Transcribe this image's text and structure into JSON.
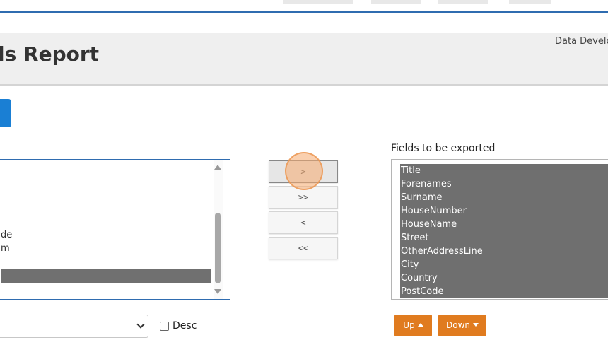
{
  "header": {
    "title": "ls Report",
    "breadcrumb": "Data Develo"
  },
  "available_fields": {
    "visible_items": [
      "de",
      "m"
    ],
    "selected_index": 2
  },
  "transfer_buttons": {
    "add": ">",
    "add_all": ">>",
    "remove": "<",
    "remove_all": "<<"
  },
  "export": {
    "label": "Fields to be exported",
    "items": [
      "Title",
      "Forenames",
      "Surname",
      "HouseNumber",
      "HouseName",
      "Street",
      "OtherAddressLine",
      "City",
      "Country",
      "PostCode"
    ]
  },
  "sort": {
    "selected": "",
    "desc_label": "Desc",
    "desc_checked": false
  },
  "order_buttons": {
    "up": "Up",
    "down": "Down"
  },
  "colors": {
    "nav_line": "#2f6cb0",
    "primary_button": "#1a7fd4",
    "order_button": "#e07b1f",
    "selected_row": "#6f6f6f"
  },
  "icons": {
    "up": "caret-up-icon",
    "down": "caret-down-icon",
    "select": "chevron-down-icon"
  }
}
